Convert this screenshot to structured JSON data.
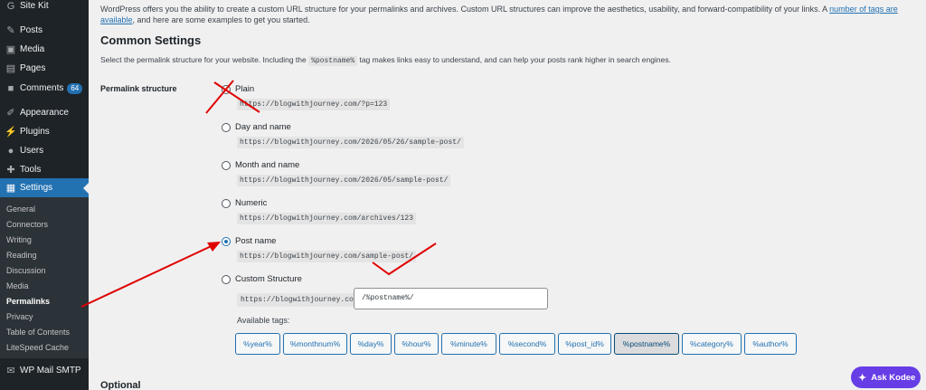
{
  "sidebar": {
    "items": [
      {
        "label": "Site Kit",
        "icon": "g-icon"
      },
      {
        "label": "Posts",
        "icon": "pin-icon"
      },
      {
        "label": "Media",
        "icon": "media-icon"
      },
      {
        "label": "Pages",
        "icon": "pages-icon"
      },
      {
        "label": "Comments",
        "icon": "comment-icon",
        "badge": "64"
      },
      {
        "label": "Appearance",
        "icon": "brush-icon"
      },
      {
        "label": "Plugins",
        "icon": "plugin-icon"
      },
      {
        "label": "Users",
        "icon": "user-icon"
      },
      {
        "label": "Tools",
        "icon": "wrench-icon"
      },
      {
        "label": "Settings",
        "icon": "settings-icon"
      }
    ],
    "submenu": [
      "General",
      "Connectors",
      "Writing",
      "Reading",
      "Discussion",
      "Media",
      "Permalinks",
      "Privacy",
      "Table of Contents",
      "LiteSpeed Cache"
    ],
    "extra": {
      "label": "WP Mail SMTP",
      "icon": "mail-icon"
    }
  },
  "main": {
    "intro_part1": "WordPress offers you the ability to create a custom URL structure for your permalinks and archives. Custom URL structures can improve the aesthetics, usability, and forward-compatibility of your links. A ",
    "intro_link": "number of tags are available",
    "intro_part2": ", and here are some examples to get you started.",
    "common_title": "Common Settings",
    "common_desc_1": "Select the permalink structure for your website. Including the ",
    "common_desc_code": "%postname%",
    "common_desc_2": " tag makes links easy to understand, and can help your posts rank higher in search engines.",
    "structure_label": "Permalink structure",
    "options": [
      {
        "label": "Plain",
        "example": "https://blogwithjourney.com/?p=123",
        "checked": false
      },
      {
        "label": "Day and name",
        "example": "https://blogwithjourney.com/2026/05/26/sample-post/",
        "checked": false
      },
      {
        "label": "Month and name",
        "example": "https://blogwithjourney.com/2026/05/sample-post/",
        "checked": false
      },
      {
        "label": "Numeric",
        "example": "https://blogwithjourney.com/archives/123",
        "checked": false
      },
      {
        "label": "Post name",
        "example": "https://blogwithjourney.com/sample-post/",
        "checked": true
      },
      {
        "label": "Custom Structure",
        "example": "",
        "checked": false
      }
    ],
    "custom_prefix": "https://blogwithjourney.com",
    "custom_value": "/%postname%/",
    "available_tags_label": "Available tags:",
    "tags": [
      "%year%",
      "%monthnum%",
      "%day%",
      "%hour%",
      "%minute%",
      "%second%",
      "%post_id%",
      "%postname%",
      "%category%",
      "%author%"
    ],
    "pressed_tag": "%postname%",
    "optional_title": "Optional"
  },
  "kodee": {
    "label": "Ask Kodee",
    "icon": "sparkle-icon"
  },
  "colors": {
    "sidebar_bg": "#1d2327",
    "accent": "#2271b1",
    "annotation": "#e00000",
    "kodee": "#673de6"
  }
}
